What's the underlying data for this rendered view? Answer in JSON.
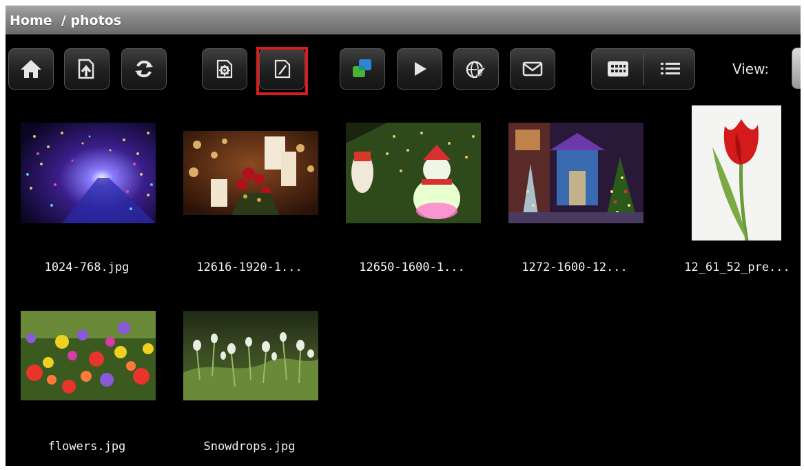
{
  "breadcrumb": "Home  / photos",
  "toolbar": {
    "home": {
      "icon": "home-icon"
    },
    "upload": {
      "icon": "upload-icon"
    },
    "refresh": {
      "icon": "refresh-icon"
    },
    "settings": {
      "icon": "settings-icon"
    },
    "edit": {
      "icon": "edit-icon",
      "highlighted": true
    },
    "share": {
      "icon": "share-windows-icon"
    },
    "play": {
      "icon": "play-icon"
    },
    "send": {
      "icon": "send-icon"
    },
    "mail": {
      "icon": "mail-icon"
    },
    "grid_view": {
      "icon": "grid-view-icon"
    },
    "list_view": {
      "icon": "list-view-icon"
    },
    "view_label": "View:"
  },
  "files": [
    {
      "name": "1024-768.jpg"
    },
    {
      "name": "12616-1920-1..."
    },
    {
      "name": "12650-1600-1..."
    },
    {
      "name": "1272-1600-12..."
    },
    {
      "name": "12_61_52_pre..."
    },
    {
      "name": "flowers.jpg"
    },
    {
      "name": "Snowdrops.jpg"
    }
  ],
  "colors": {
    "highlight": "#d91c1c",
    "background": "#000000"
  }
}
